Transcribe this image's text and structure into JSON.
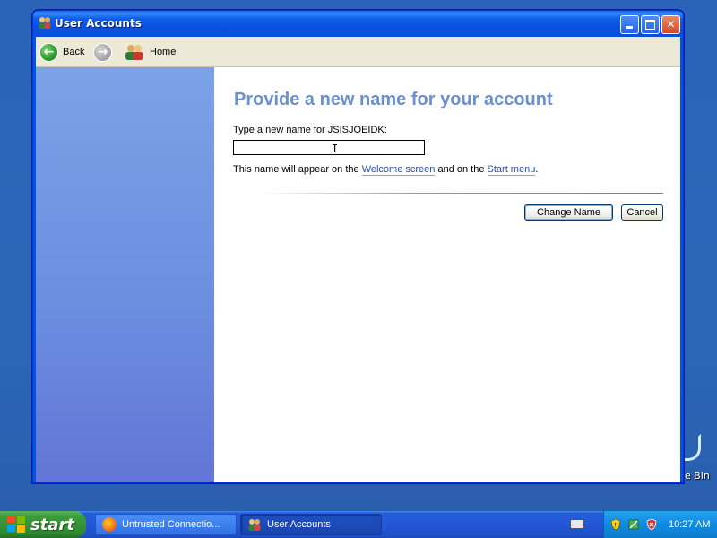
{
  "window": {
    "title": "User Accounts"
  },
  "toolbar": {
    "back_label": "Back",
    "home_label": "Home"
  },
  "main": {
    "heading": "Provide a new name for your account",
    "prompt": "Type a new name for JSISJOEIDK:",
    "name_value": "",
    "info_prefix": "This name will appear on the ",
    "info_link1": "Welcome screen",
    "info_middle": " and on the ",
    "info_link2": "Start menu",
    "info_suffix": ".",
    "change_button": "Change Name",
    "cancel_button": "Cancel"
  },
  "desktop": {
    "recycle_label": "e Bin"
  },
  "taskbar": {
    "start_label": "start",
    "tasks": [
      {
        "label": "Untrusted Connectio..."
      },
      {
        "label": "User Accounts"
      }
    ],
    "clock": "10:27 AM"
  },
  "colors": {
    "heading": "#6a8fd3",
    "link": "#2c4fa3",
    "titlebar": "#0054e3",
    "start_green": "#3c9d3c",
    "tray_blue": "#0f8ae1"
  }
}
